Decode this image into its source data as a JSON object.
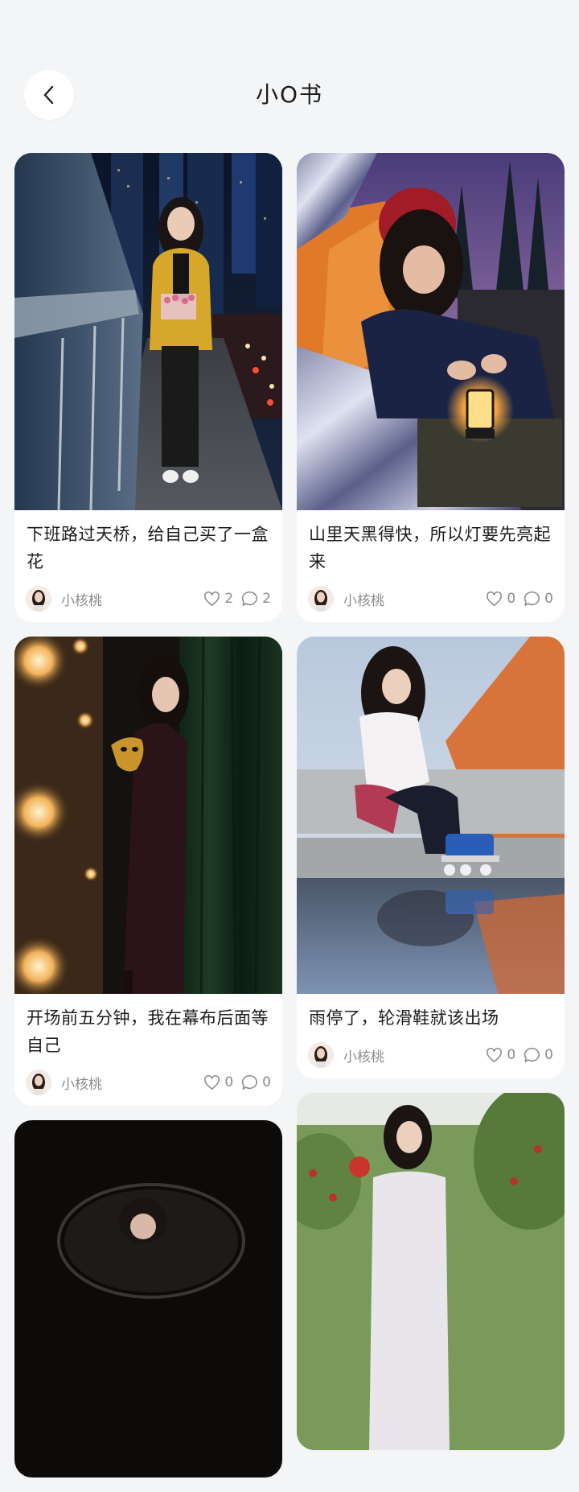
{
  "header": {
    "title": "小O书"
  },
  "posts": [
    {
      "title": "下班路过天桥，给自己买了一盒花",
      "author": "小核桃",
      "likes": "2",
      "comments": "2"
    },
    {
      "title": "山里天黑得快，所以灯要先亮起来",
      "author": "小核桃",
      "likes": "0",
      "comments": "0"
    },
    {
      "title": "开场前五分钟，我在幕布后面等自己",
      "author": "小核桃",
      "likes": "0",
      "comments": "0"
    },
    {
      "title": "雨停了，轮滑鞋就该出场",
      "author": "小核桃",
      "likes": "0",
      "comments": "0"
    }
  ],
  "colors": {
    "background": "#f4f5f7",
    "card": "#ffffff",
    "text": "#1c1c1c",
    "muted": "#8b8b8b"
  }
}
